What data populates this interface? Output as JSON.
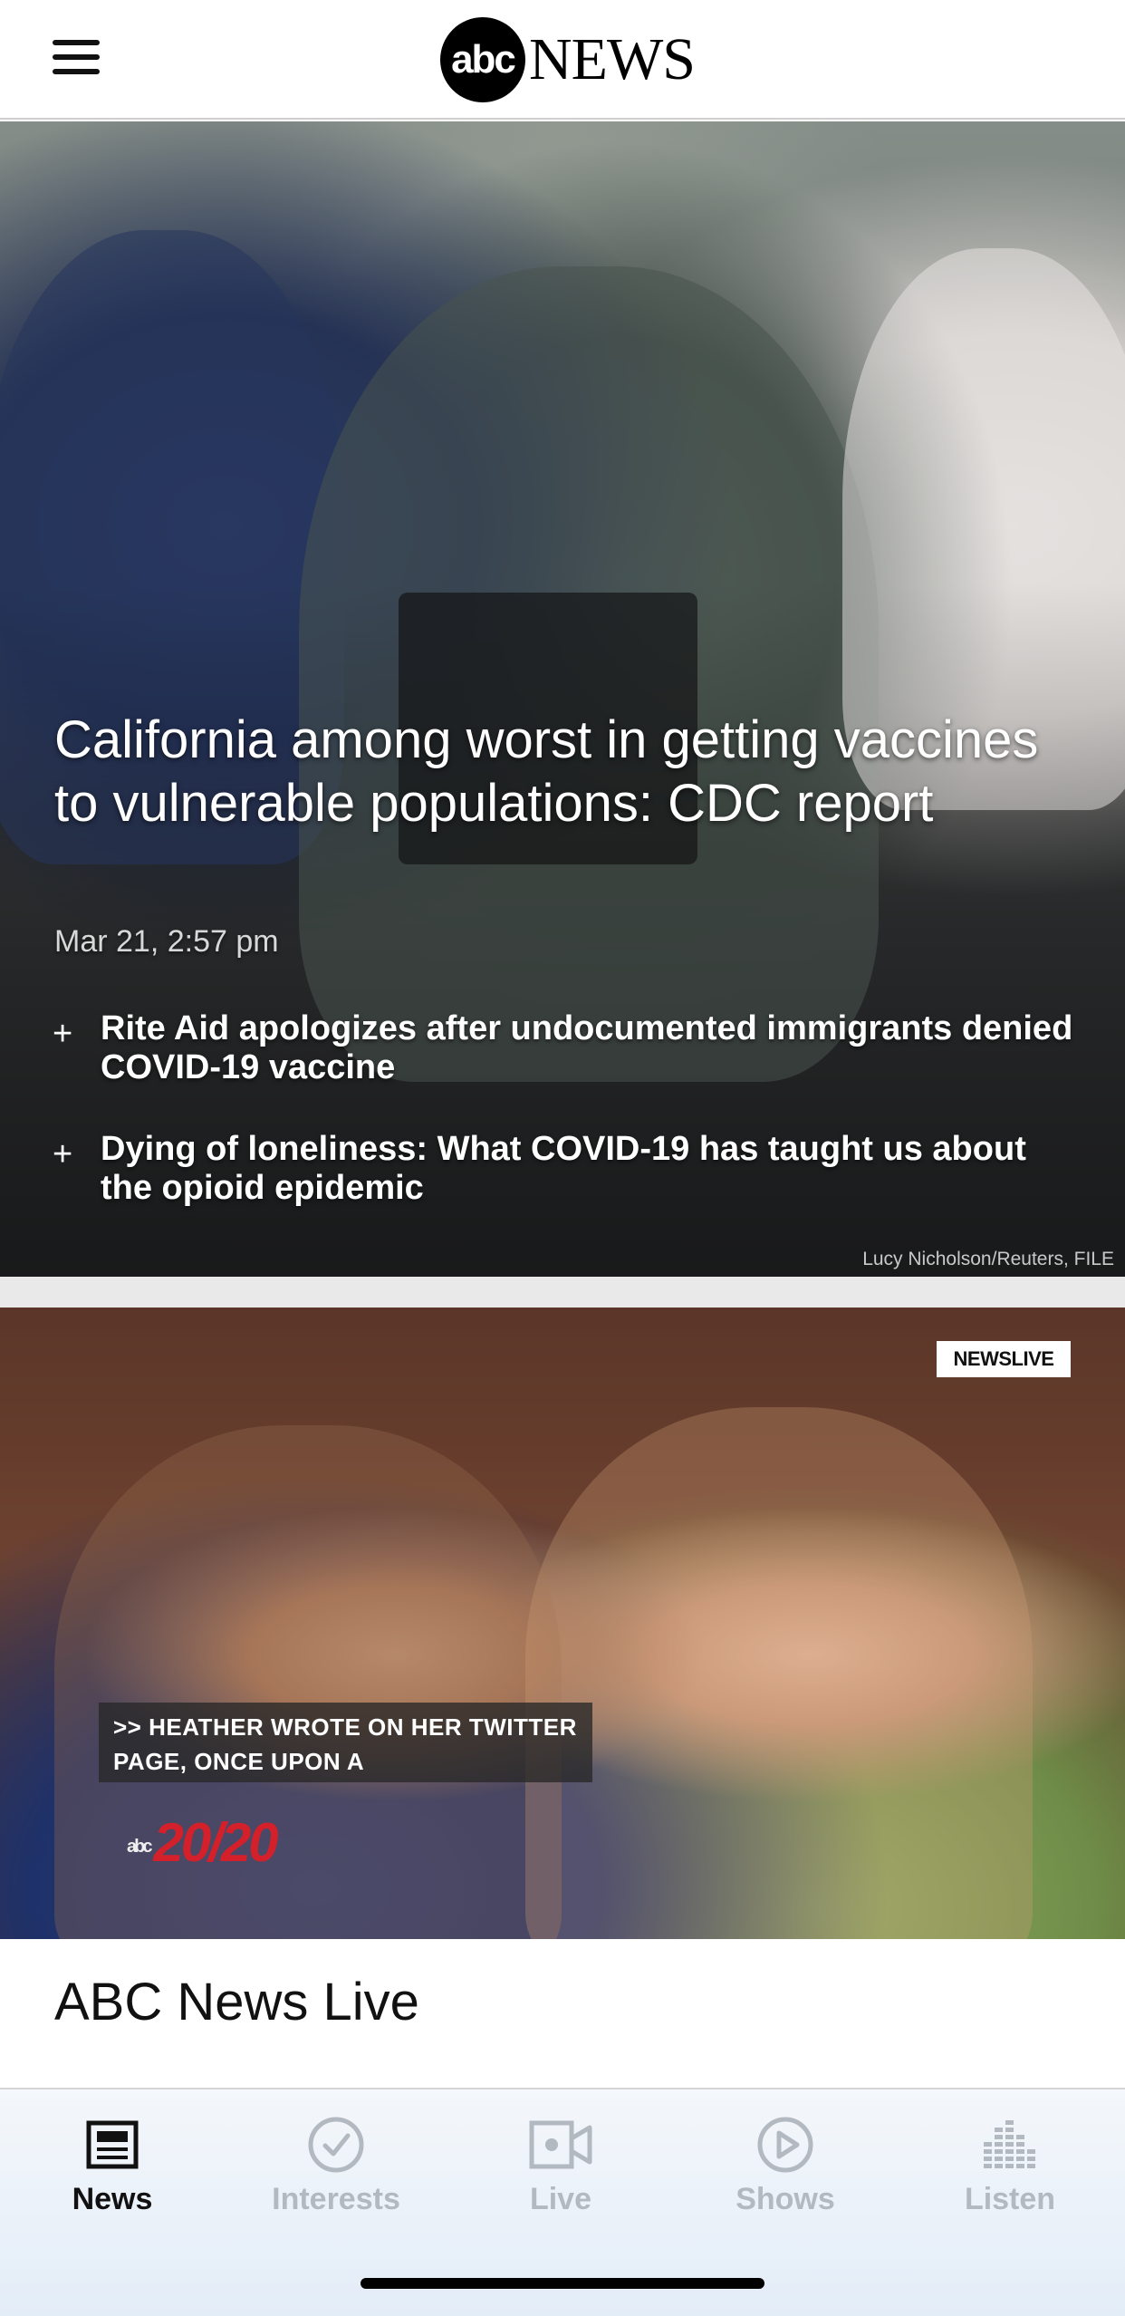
{
  "header": {
    "logo_abc": "abc",
    "logo_news": "NEWS"
  },
  "hero": {
    "title": "California among worst in getting vaccines to vulnerable populations: CDC report",
    "date": "Mar 21, 2:57 pm",
    "related": [
      {
        "text": "Rite Aid apologizes after undocumented immigrants denied COVID-19 vaccine"
      },
      {
        "text": "Dying of loneliness: What COVID-19 has taught us about the opioid epidemic"
      }
    ],
    "credit": "Lucy Nicholson/Reuters, FILE"
  },
  "video": {
    "live_bug": "NEWSLIVE",
    "captions": [
      ">> HEATHER WROTE ON HER TWITTER",
      "PAGE, ONCE UPON A"
    ],
    "watermark": "20/20",
    "watermark_abc": "abc"
  },
  "section": {
    "title": "ABC News Live"
  },
  "tabs": [
    {
      "label": "News",
      "icon": "newspaper-icon",
      "active": true
    },
    {
      "label": "Interests",
      "icon": "checkmark-circle-icon",
      "active": false
    },
    {
      "label": "Live",
      "icon": "video-camera-icon",
      "active": false
    },
    {
      "label": "Shows",
      "icon": "play-circle-icon",
      "active": false
    },
    {
      "label": "Listen",
      "icon": "equalizer-icon",
      "active": false
    }
  ],
  "colors": {
    "active_tab": "#111111",
    "inactive_tab": "#b3b9c0",
    "tabbar_bg": "#e8f0f9",
    "watermark_red": "#d4202a"
  }
}
